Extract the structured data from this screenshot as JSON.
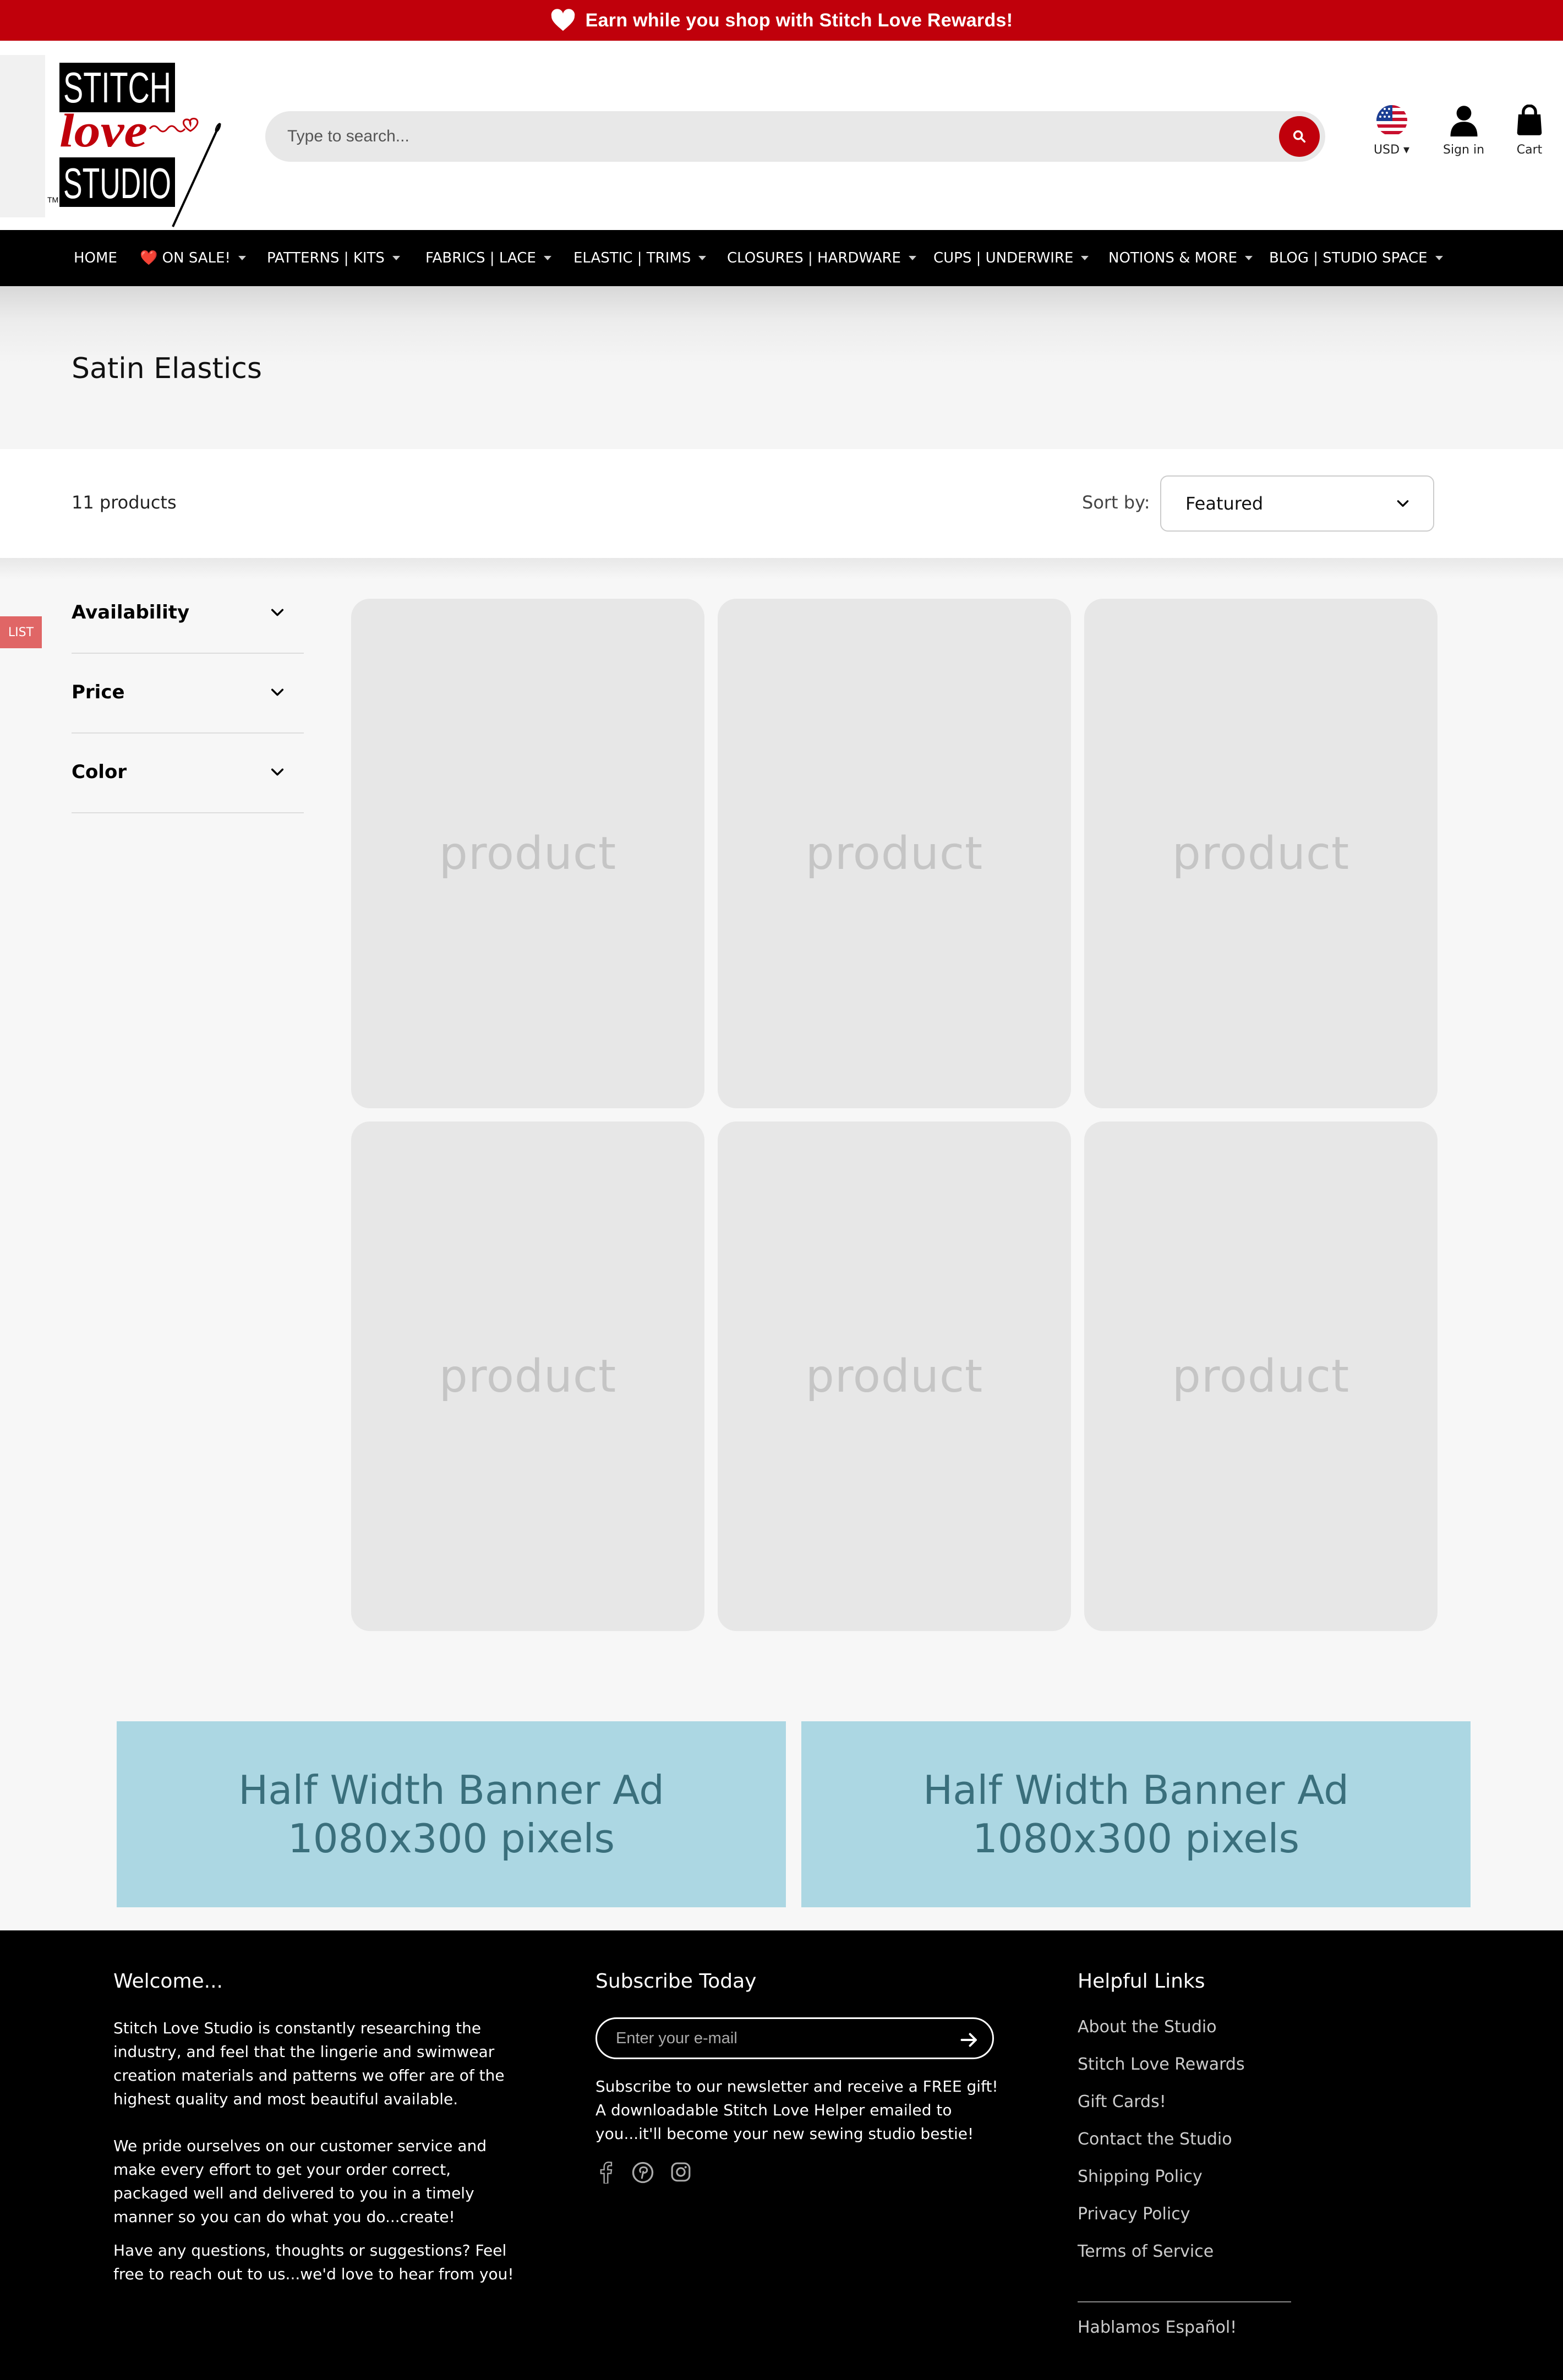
{
  "announcement": {
    "text": "Earn while you shop with Stitch Love Rewards!"
  },
  "logo": {
    "line1": "STITCH",
    "line2": "love",
    "line3": "STUDIO",
    "tm": "TM"
  },
  "search": {
    "placeholder": "Type to search..."
  },
  "header_icons": {
    "currency": "USD",
    "signin": "Sign in",
    "cart": "Cart"
  },
  "nav": {
    "items": [
      {
        "label": "HOME",
        "dropdown": false
      },
      {
        "label": "❤️ ON SALE!",
        "dropdown": true
      },
      {
        "label": "PATTERNS | KITS",
        "dropdown": true
      },
      {
        "label": "FABRICS | LACE",
        "dropdown": true
      },
      {
        "label": "ELASTIC | TRIMS",
        "dropdown": true
      },
      {
        "label": "CLOSURES | HARDWARE",
        "dropdown": true
      },
      {
        "label": "CUPS | UNDERWIRE",
        "dropdown": true
      },
      {
        "label": "NOTIONS & MORE",
        "dropdown": true
      },
      {
        "label": "BLOG | STUDIO SPACE",
        "dropdown": true
      }
    ]
  },
  "collection": {
    "title": "Satin Elastics",
    "count": "11 products",
    "sort_label": "Sort by:",
    "sort_value": "Featured"
  },
  "side_tab": {
    "label": "LIST"
  },
  "filters": [
    "Availability",
    "Price",
    "Color"
  ],
  "products": {
    "placeholder": "product"
  },
  "banners": [
    {
      "line1": "Half Width Banner Ad",
      "line2": "1080x300 pixels"
    },
    {
      "line1": "Half Width Banner Ad",
      "line2": "1080x300 pixels"
    }
  ],
  "footer": {
    "welcome": {
      "heading": "Welcome...",
      "p1": "Stitch Love Studio is constantly researching the industry, and feel that the lingerie and swimwear creation materials and patterns we offer are of the highest quality and most beautiful available.",
      "p2": "We pride ourselves on our customer service and make every effort to get your order correct, packaged well and delivered to you in a timely manner so you can do what you do...create!",
      "p3": "Have any questions, thoughts or suggestions? Feel free to reach out to us...we'd love to hear from you!"
    },
    "subscribe": {
      "heading": "Subscribe Today",
      "placeholder": "Enter your e-mail",
      "text": "Subscribe to our newsletter and receive a FREE gift! A downloadable Stitch Love Helper emailed to you...it'll become your new sewing studio bestie!",
      "social": [
        "facebook-icon",
        "pinterest-icon",
        "instagram-icon"
      ]
    },
    "links": {
      "heading": "Helpful Links",
      "items": [
        "About the Studio",
        "Stitch Love Rewards",
        "Gift Cards!",
        "Contact the Studio",
        "Shipping Policy",
        "Privacy Policy",
        "Terms of Service"
      ],
      "language": "Hablamos Español!"
    }
  },
  "colors": {
    "brand_red": "#c0000b",
    "banner_blue": "#acd7e3",
    "footer_bg": "#000000"
  }
}
